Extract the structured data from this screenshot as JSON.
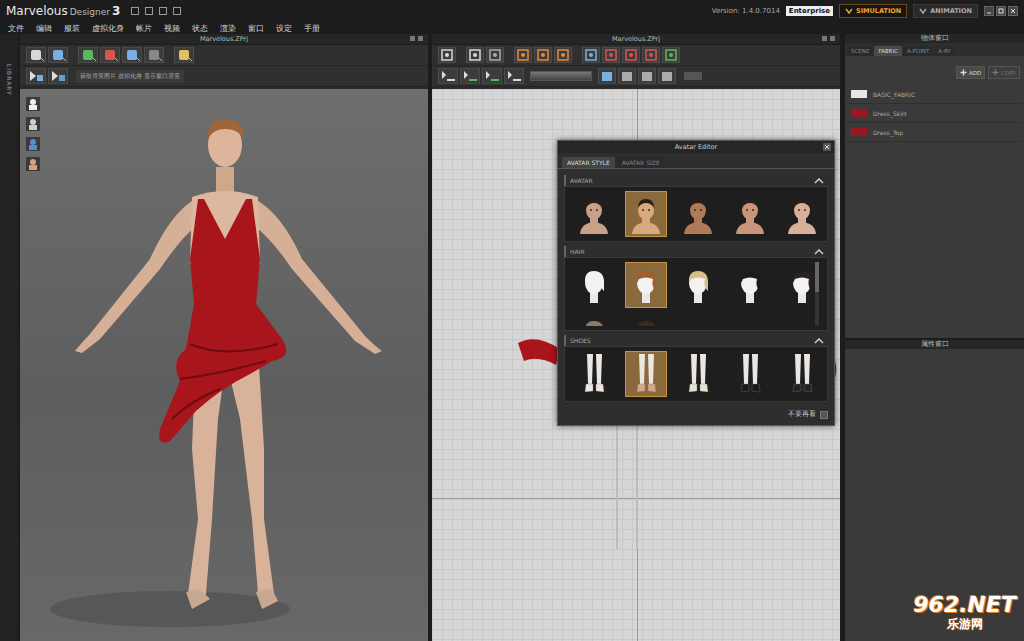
{
  "window": {
    "brand": "Marvelous",
    "product": "Designer",
    "major": "3",
    "version": "Version: 1.4.0.7014",
    "edition": "Enterprise"
  },
  "modes": [
    {
      "label": "SIMULATION",
      "selected": true
    },
    {
      "label": "ANIMATION",
      "selected": false
    }
  ],
  "menu": [
    "文件",
    "编辑",
    "服装",
    "虚拟化身",
    "帐片",
    "视频",
    "状态",
    "渲染",
    "窗口",
    "设定",
    "手册"
  ],
  "library": {
    "label": "LIBRARY"
  },
  "view3d": {
    "title": "Marvelous.ZPrj",
    "hint": "获取背景图片 虚拟化身 显示窗口背景",
    "dress_color": "#a8151b"
  },
  "view2d": {
    "title": "Marvelous.ZPrj",
    "pattern_color": "#a8151b"
  },
  "avatar_editor": {
    "title": "Avatar Editor",
    "tabs": [
      {
        "label": "AVATAR STYLE",
        "selected": true
      },
      {
        "label": "AVATAR SIZE",
        "selected": false
      }
    ],
    "sections": [
      {
        "label": "AVATAR",
        "kind": "avatar",
        "items": [
          {
            "selected": false,
            "color": "#c9a088"
          },
          {
            "selected": true,
            "color": "#d8a87e"
          },
          {
            "selected": false,
            "color": "#b07a58"
          },
          {
            "selected": false,
            "color": "#c9967a"
          },
          {
            "selected": false,
            "color": "#d8b09a"
          }
        ]
      },
      {
        "label": "HAIR",
        "kind": "hair",
        "items": [
          {
            "selected": false,
            "color": "#f2f2f2"
          },
          {
            "selected": true,
            "color": "#a0602e"
          },
          {
            "selected": false,
            "color": "#d9c08a"
          },
          {
            "selected": false,
            "color": "#1e1a18"
          },
          {
            "selected": false,
            "color": "#2a2320"
          },
          {
            "selected": false,
            "color": "#8a7a6a"
          },
          {
            "selected": false,
            "color": "#3a2a22"
          }
        ]
      },
      {
        "label": "SHOES",
        "kind": "shoes",
        "items": [
          {
            "selected": false,
            "color": "#f0e6e0"
          },
          {
            "selected": true,
            "color": "#d6a88a"
          },
          {
            "selected": false,
            "color": "#dfe8d0"
          },
          {
            "selected": false,
            "color": "#1a1a1a"
          },
          {
            "selected": false,
            "color": "#2a2420"
          }
        ]
      }
    ],
    "footer": {
      "label": "不要再看",
      "checked": false
    }
  },
  "object_window": {
    "title": "物体窗口",
    "tabs": [
      {
        "label": "SCENE",
        "selected": false
      },
      {
        "label": "FABRIC",
        "selected": true
      },
      {
        "label": "A-POINT",
        "selected": false
      },
      {
        "label": "A-RY",
        "selected": false
      }
    ],
    "buttons": [
      {
        "label": "ADD",
        "disabled": false
      },
      {
        "label": "COPY",
        "disabled": true
      }
    ],
    "fabrics": [
      {
        "name": "BASIC_FABRIC",
        "color": "#e6e6e6"
      },
      {
        "name": "Dress_Skirt",
        "color": "#9b1620"
      },
      {
        "name": "Dress_Top",
        "color": "#9b1620"
      }
    ]
  },
  "property_window": {
    "title": "属性窗口"
  },
  "watermark": {
    "brand": "962.NET",
    "site": "乐游网"
  }
}
